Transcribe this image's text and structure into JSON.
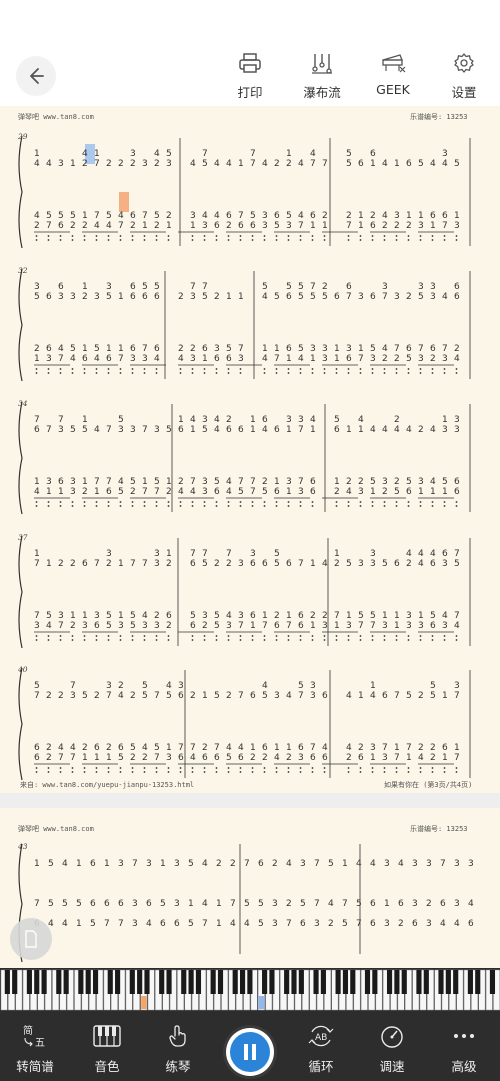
{
  "toolbar": {
    "print_label": "打印",
    "waterfall_label": "瀑布流",
    "geek_label": "GEEK",
    "settings_label": "设置"
  },
  "sheet": {
    "site_left": "弹琴吧 www.tan8.com",
    "score_no_left": "乐谱编号: 13253",
    "source_url": "来自: www.tan8.com/yuepu-jianpu-13253.html",
    "page_info": "如果有你在 (第3页/共4页)",
    "site_left_2": "弹琴吧 www.tan8.com",
    "score_no_left_2": "乐谱编号: 13253"
  },
  "measures": {
    "m29": "29",
    "m32": "32",
    "m34": "34",
    "m37": "37",
    "m40": "40",
    "m43": "43"
  },
  "bottom_nav": {
    "simplify_label": "转简谱",
    "simplify_icon_top": "简",
    "simplify_icon_bottom": "五",
    "tone_label": "音色",
    "practice_label": "练琴",
    "loop_label": "循环",
    "loop_icon_text": "AB",
    "speed_label": "调速",
    "advanced_label": "高级"
  },
  "colors": {
    "paper": "#fbf6e7",
    "note_highlight_blue": "#8fb9ef",
    "note_highlight_orange": "#f4a06a",
    "play_button": "#2c84d9",
    "nav_bg": "#2d2d2d"
  }
}
